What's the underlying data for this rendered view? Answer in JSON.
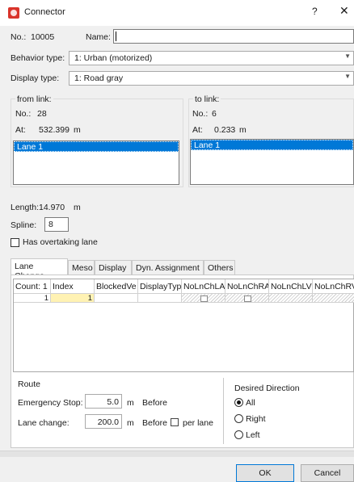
{
  "window": {
    "title": "Connector",
    "help_icon": "question-mark",
    "close_icon": "close-x"
  },
  "header": {
    "no_label": "No.:",
    "no_value": "10005",
    "name_label": "Name:",
    "name_value": "",
    "behavior_label": "Behavior type:",
    "behavior_value": "1: Urban (motorized)",
    "display_label": "Display type:",
    "display_value": "1: Road gray"
  },
  "from_link": {
    "title": "from link:",
    "no_label": "No.:",
    "no_value": "28",
    "at_label": "At:",
    "at_value": "532.399",
    "unit": "m",
    "lanes": [
      "Lane  1"
    ]
  },
  "to_link": {
    "title": "to link:",
    "no_label": "No.:",
    "no_value": "6",
    "at_label": "At:",
    "at_value": "0.233",
    "unit": "m",
    "lanes": [
      "Lane  1"
    ]
  },
  "length": {
    "label": "Length:",
    "value": "14.970",
    "unit": "m"
  },
  "spline": {
    "label": "Spline:",
    "value": "8"
  },
  "overtaking": {
    "label": "Has overtaking lane",
    "checked": false
  },
  "tabs": [
    "Lane Change",
    "Meso",
    "Display",
    "Dyn. Assignment",
    "Others"
  ],
  "active_tab": "Lane Change",
  "grid": {
    "headers": [
      "Count: 1",
      "Index",
      "BlockedVe",
      "DisplayTyp",
      "NoLnChLA",
      "NoLnChRA",
      "NoLnChLV",
      "NoLnChRV"
    ],
    "rows": [
      {
        "count": "1",
        "index": "1"
      }
    ]
  },
  "route": {
    "title": "Route",
    "emergency_label": "Emergency Stop:",
    "emergency_value": "5.0",
    "emergency_unit": "m",
    "emergency_suffix": "Before",
    "lanechange_label": "Lane change:",
    "lanechange_value": "200.0",
    "lanechange_unit": "m",
    "lanechange_suffix": "Before",
    "per_lane_label": "per lane"
  },
  "direction": {
    "title": "Desired Direction",
    "options": [
      "All",
      "Right",
      "Left"
    ],
    "selected": "All"
  },
  "buttons": {
    "ok": "OK",
    "cancel": "Cancel"
  },
  "colors": {
    "selection": "#0078d7",
    "accent_icon": "#d9342b",
    "index_cell": "#fff2b3"
  }
}
